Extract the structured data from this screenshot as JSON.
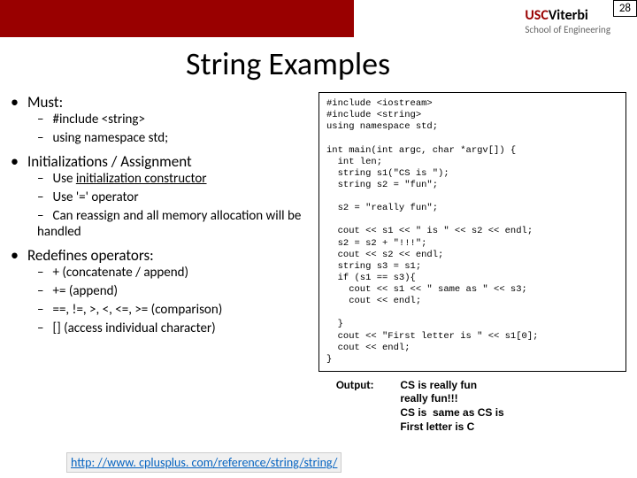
{
  "page_number": "28",
  "logo_text_usc": "USC",
  "logo_text_v": "Viterbi",
  "logo_sub": "School of Engineering",
  "title": "String Examples",
  "bullets": {
    "b1": "Must:",
    "b1s1": "#include <string>",
    "b1s2": "using namespace std;",
    "b2": "Initializations / Assignment",
    "b2s1a": "Use ",
    "b2s1b": "initialization constructor",
    "b2s2": "Use '=' operator",
    "b2s3": "Can reassign and all memory allocation will be handled",
    "b3": "Redefines operators:",
    "b3s1": "+ (concatenate / append)",
    "b3s2": "+= (append)",
    "b3s3": "==, !=, >, <, <=, >= (comparison)",
    "b3s4": "[] (access individual character)"
  },
  "code": "#include <iostream>\n#include <string>\nusing namespace std;\n\nint main(int argc, char *argv[]) {\n  int len;\n  string s1(\"CS is \");\n  string s2 = \"fun\";\n\n  s2 = \"really fun\";\n\n  cout << s1 << \" is \" << s2 << endl;\n  s2 = s2 + \"!!!\";\n  cout << s2 << endl;\n  string s3 = s1;\n  if (s1 == s3){\n    cout << s1 << \" same as \" << s3;\n    cout << endl;\n\n  }\n  cout << \"First letter is \" << s1[0];\n  cout << endl;\n}",
  "output_label": "Output:",
  "output_text": "CS is really fun\nreally fun!!!\nCS is  same as CS is\nFirst letter is C",
  "footer_link": "http: //www. cplusplus. com/reference/string/string/"
}
